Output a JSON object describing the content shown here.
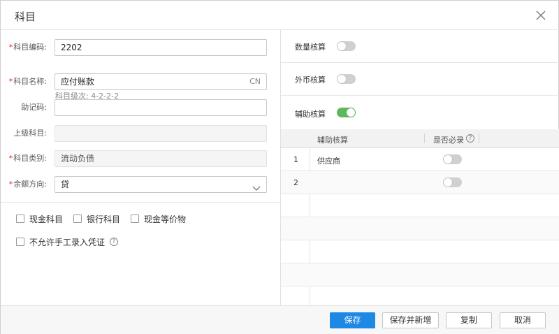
{
  "dialog": {
    "title": "科目"
  },
  "form": {
    "code": {
      "label": "科目编码:",
      "required": true,
      "value": "2202",
      "hint": "科目级次: 4-2-2-2"
    },
    "name": {
      "label": "科目名称:",
      "required": true,
      "value": "应付账款",
      "lang": "CN"
    },
    "mnemonic": {
      "label": "助记码:",
      "required": false,
      "value": ""
    },
    "parent": {
      "label": "上级科目:",
      "required": false,
      "value": ""
    },
    "category": {
      "label": "科目类别:",
      "required": true,
      "value": "流动负债"
    },
    "direction": {
      "label": "余额方向:",
      "required": true,
      "value": "贷"
    },
    "checkboxes": [
      {
        "label": "现金科目",
        "checked": false
      },
      {
        "label": "银行科目",
        "checked": false
      },
      {
        "label": "现金等价物",
        "checked": false
      },
      {
        "label": "不允许手工录入凭证",
        "checked": false
      }
    ]
  },
  "options": {
    "quantity": {
      "label": "数量核算",
      "on": false
    },
    "foreign": {
      "label": "外币核算",
      "on": false
    },
    "auxiliary": {
      "label": "辅助核算",
      "on": true
    }
  },
  "aux_table": {
    "headers": [
      "辅助核算",
      "是否必录"
    ],
    "rows": [
      {
        "index": "1",
        "name": "供应商",
        "required": false
      },
      {
        "index": "2",
        "name": "",
        "required": false
      }
    ]
  },
  "footer": {
    "save": "保存",
    "save_new": "保存并新增",
    "copy": "复制",
    "cancel": "取消"
  },
  "colors": {
    "primary": "#1e88e5",
    "toggle_on": "#5cb85c",
    "required": "#e02020"
  }
}
